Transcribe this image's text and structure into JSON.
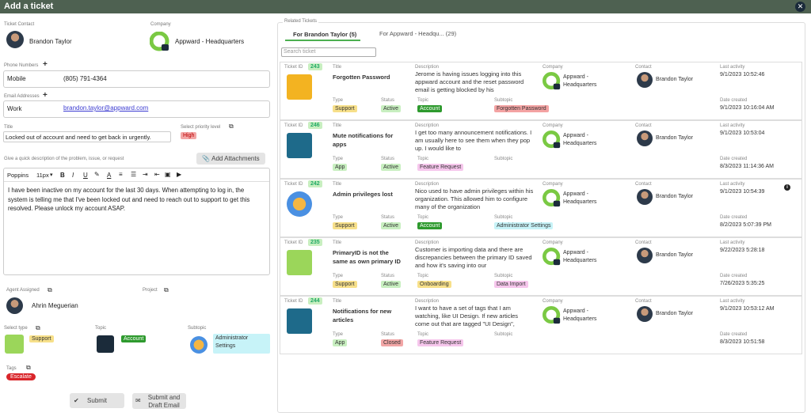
{
  "window": {
    "title": "Add a ticket",
    "close_glyph": "✕"
  },
  "contact": {
    "label": "Ticket Contact",
    "name": "Brandon Taylor"
  },
  "company": {
    "label": "Company",
    "name": "Appward - Headquarters"
  },
  "phones": {
    "label": "Phone Numbers",
    "type": "Mobile",
    "value": "(805) 791-4364"
  },
  "emails": {
    "label": "Email Addresses",
    "type": "Work",
    "value": "brandon.taylor@appward.com"
  },
  "title_field": {
    "label": "Title",
    "value": "Locked out of account and need to get back in urgently."
  },
  "priority": {
    "label": "Select priority level",
    "value": "High"
  },
  "description": {
    "label": "Give a quick description of the problem, issue, or request",
    "attach_label": "Add Attachments",
    "font": "Poppins",
    "size": "11px",
    "body": "I have been inactive on my account for the last 30 days. When attempting to log in, the system is telling me that I've been locked out and need to reach out to support to get this resolved. Please unlock my account ASAP."
  },
  "agent": {
    "label": "Agent Assigned",
    "name": "Ahrin Meguerian"
  },
  "project": {
    "label": "Project"
  },
  "type_sel": {
    "label": "Select type",
    "value": "Support"
  },
  "topic": {
    "label": "Topic",
    "value": "Account"
  },
  "subtopic": {
    "label": "Subtopic",
    "value": "Administrator Settings"
  },
  "tags": {
    "label": "Tags",
    "value": "Escalate"
  },
  "actions": {
    "submit": "Submit",
    "submit_draft": "Submit and Draft Email"
  },
  "related": {
    "label": "Related Tickets",
    "tab1": "For Brandon Taylor (5)",
    "tab2": "For Appward - Headqu... (29)",
    "search_placeholder": "Search ticket",
    "k": {
      "id": "Ticket ID",
      "title": "Title",
      "desc": "Description",
      "company": "Company",
      "contact": "Contact",
      "last": "Last activity",
      "type": "Type",
      "status": "Status",
      "topic": "Topic",
      "subtopic": "Subtopic",
      "created": "Date created"
    },
    "tickets": [
      {
        "id": "243",
        "title": "Forgotten Password",
        "desc": "Jerome is having issues logging into this appward account and the reset password email is getting blocked by his",
        "company": "Appward - Headquarters",
        "contact": "Brandon Taylor",
        "last": "9/1/2023 10:52:46",
        "created": "9/1/2023 10:16:04 AM",
        "type": "Support",
        "status": "Active",
        "topic": "Account",
        "subtopic": "Forgotten Password"
      },
      {
        "id": "246",
        "title": "Mute notifications for apps",
        "desc": "I get too many announcement notifications. I am usually here to see them when they pop up. I would like to",
        "company": "Appward - Headquarters",
        "contact": "Brandon Taylor",
        "last": "9/1/2023 10:53:04",
        "created": "8/3/2023 11:14:36 AM",
        "type": "App",
        "status": "Active",
        "topic": "Feature Request",
        "subtopic": ""
      },
      {
        "id": "242",
        "title": "Admin privileges lost",
        "desc": "Nico used to have admin privileges within his organization. This allowed him to configure many of the organization",
        "company": "Appward - Headquarters",
        "contact": "Brandon Taylor",
        "last": "9/1/2023 10:54:39",
        "created": "8/2/2023 5:07:39 PM",
        "type": "Support",
        "status": "Active",
        "topic": "Account",
        "subtopic": "Administrator Settings"
      },
      {
        "id": "235",
        "title": "PrimaryID is not the same as own primary ID",
        "desc": "Customer is importing data and there are discrepancies between the primary ID saved and how it's saving into our",
        "company": "Appward - Headquarters",
        "contact": "Brandon Taylor",
        "last": "9/22/2023 5:28:18",
        "created": "7/26/2023 5:35:25",
        "type": "Support",
        "status": "Active",
        "topic": "Onboarding",
        "subtopic": "Data Import"
      },
      {
        "id": "244",
        "title": "Notifications for new articles",
        "desc": "I want to have a set of tags that I am watching, like UI Design. If new articles come out that are tagged \"UI Design\",",
        "company": "Appward - Headquarters",
        "contact": "Brandon Taylor",
        "last": "9/1/2023 10:53:12 AM",
        "created": "8/3/2023 10:51:58",
        "type": "App",
        "status": "Closed",
        "topic": "Feature Request",
        "subtopic": ""
      }
    ]
  },
  "colors": {
    "header": "#4e6151",
    "accent": "#4caf50",
    "type_yellow": "#f7e08a",
    "status_green": "#c8efc0",
    "status_red": "#f2a6a6",
    "topic_green": "#2e9a2e",
    "topic_pink": "#f6c6ec",
    "sub_red": "#f4a3a3",
    "sub_cyan": "#c7f3f8"
  }
}
